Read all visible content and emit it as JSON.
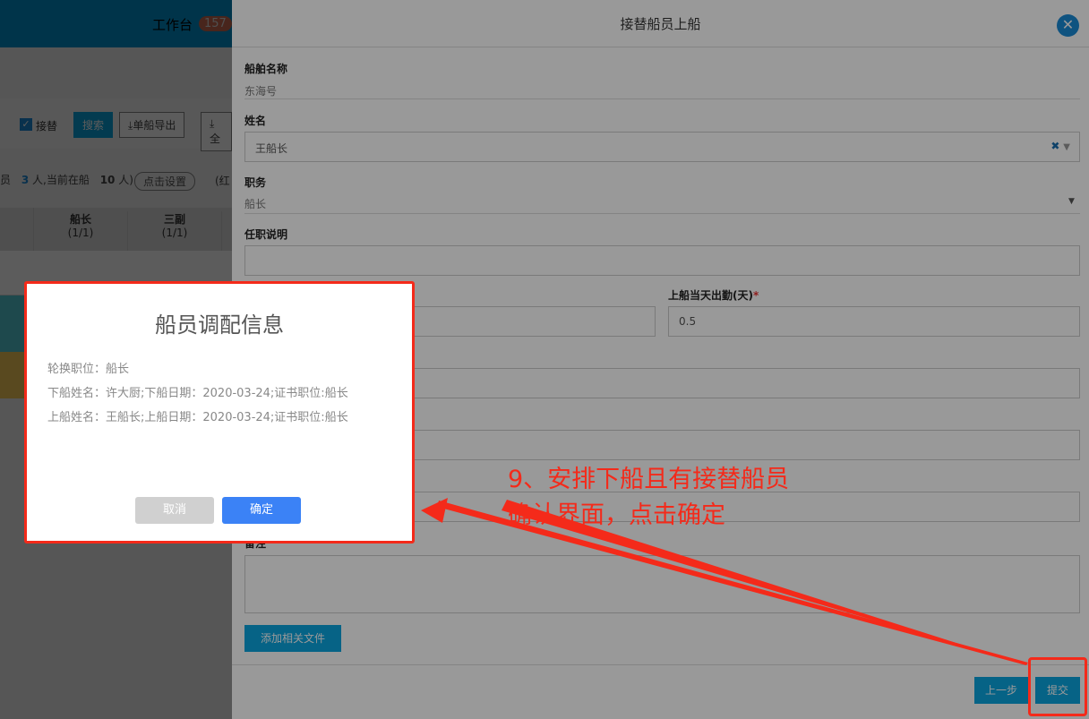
{
  "background": {
    "header_title": "工作台",
    "badge": "157",
    "toolbar": {
      "checkbox_label": "接替",
      "checked": true,
      "search": "搜索",
      "export_single": "单船导出",
      "export_all": "全"
    },
    "summary": {
      "prefix": "员",
      "count1": "3",
      "mid": "人,当前在船",
      "count2": "10",
      "suffix": "人)",
      "settings": "点击设置",
      "hint": "(红"
    },
    "columns": [
      {
        "name": "船长",
        "count": "(1/1)"
      },
      {
        "name": "三副",
        "count": "(1/1)"
      }
    ]
  },
  "drawer": {
    "title": "接替船员上船",
    "ship_label": "船舶名称",
    "ship_value": "东海号",
    "name_label": "姓名",
    "name_value": "王船长",
    "position_label": "职务",
    "position_value": "船长",
    "desc_label": "任职说明",
    "desc_value": "",
    "attendance_label": "上船当天出勤(天)",
    "attendance_value": "0.5",
    "remark_label": "备注",
    "add_file": "添加相关文件",
    "prev": "上一步",
    "submit": "提交"
  },
  "dialog": {
    "title": "船员调配信息",
    "line1": "轮换职位：船长",
    "line2": "下船姓名：许大厨;下船日期：2020-03-24;证书职位:船长",
    "line3": "上船姓名：王船长;上船日期：2020-03-24;证书职位:船长",
    "cancel": "取消",
    "confirm": "确定"
  },
  "annotation": {
    "line1": "9、安排下船且有接替船员",
    "line2": "确认界面，点击确定",
    "color": "#f42a1a"
  }
}
